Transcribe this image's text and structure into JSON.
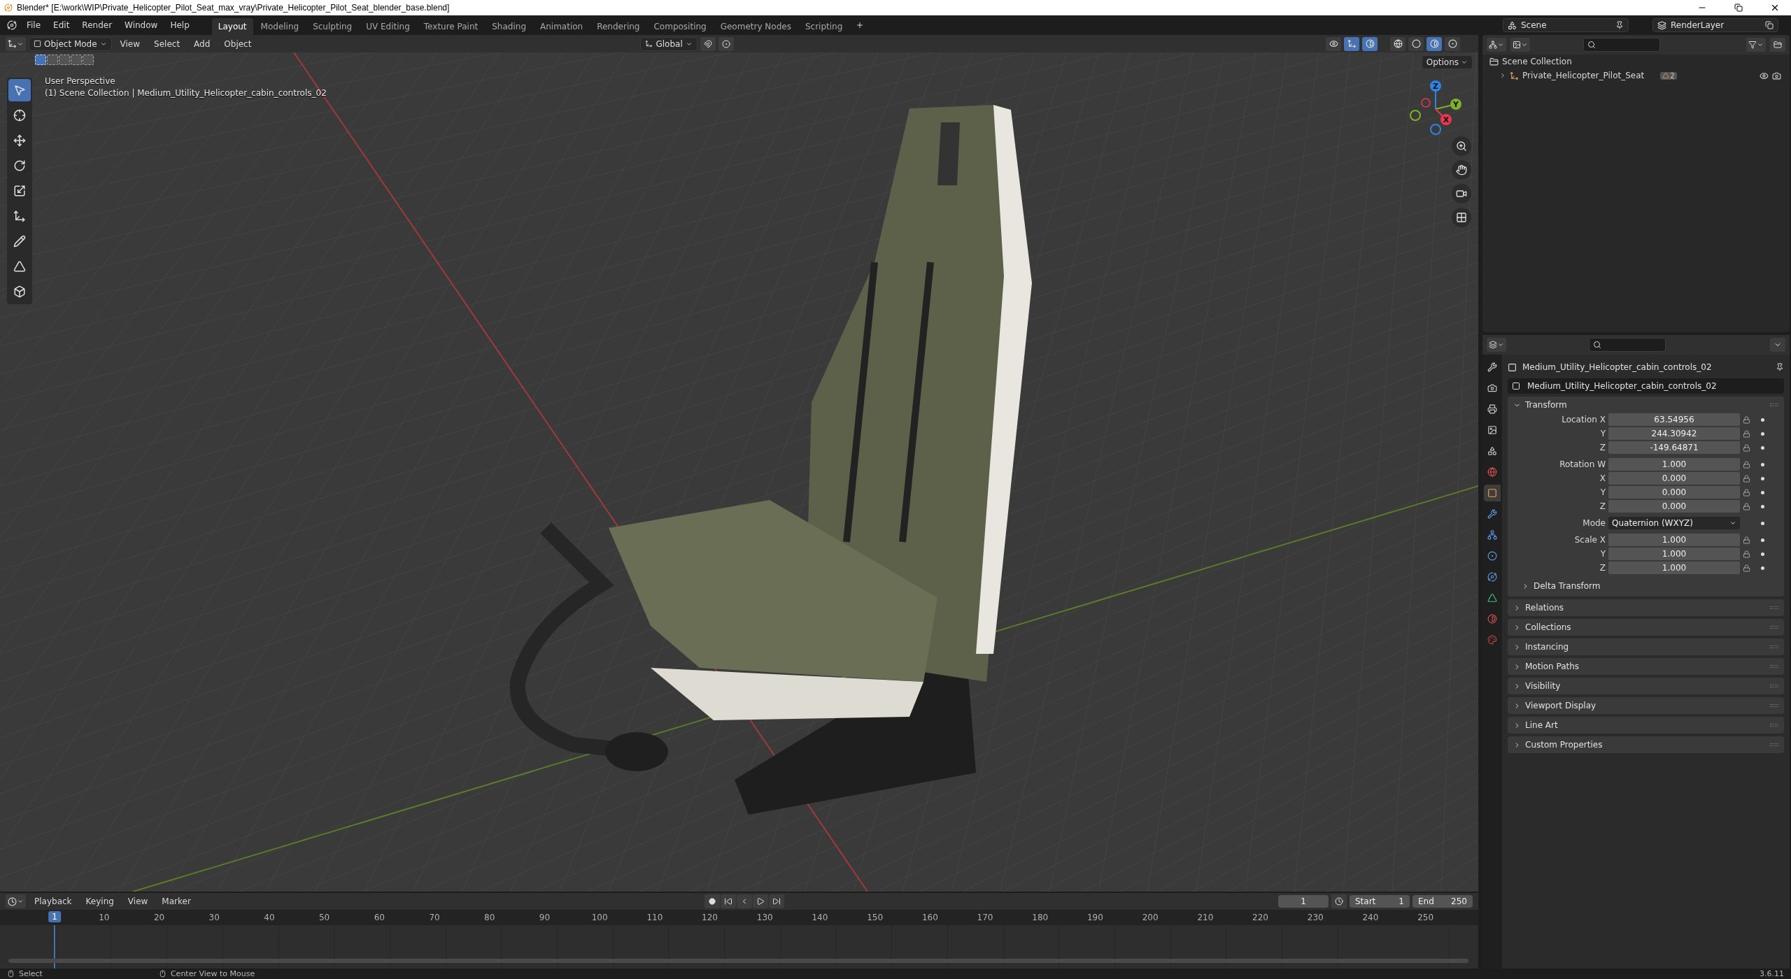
{
  "window": {
    "title": "Blender* [E:\\work\\WIP\\Private_Helicopter_Pilot_Seat_max_vray\\Private_Helicopter_Pilot_Seat_blender_base.blend]"
  },
  "menu": [
    "File",
    "Edit",
    "Render",
    "Window",
    "Help"
  ],
  "workspaces": [
    {
      "label": "Layout",
      "selected": true
    },
    {
      "label": "Modeling",
      "selected": false
    },
    {
      "label": "Sculpting",
      "selected": false
    },
    {
      "label": "UV Editing",
      "selected": false
    },
    {
      "label": "Texture Paint",
      "selected": false
    },
    {
      "label": "Shading",
      "selected": false
    },
    {
      "label": "Animation",
      "selected": false
    },
    {
      "label": "Rendering",
      "selected": false
    },
    {
      "label": "Compositing",
      "selected": false
    },
    {
      "label": "Geometry Nodes",
      "selected": false
    },
    {
      "label": "Scripting",
      "selected": false
    }
  ],
  "scene": {
    "name": "Scene",
    "view_layer": "RenderLayer"
  },
  "viewport": {
    "mode": "Object Mode",
    "menus": [
      "View",
      "Select",
      "Add",
      "Object"
    ],
    "orientation": "Global",
    "options": "Options",
    "select_modes": [
      {
        "selected": true
      },
      {
        "selected": false
      },
      {
        "selected": false
      },
      {
        "selected": false
      },
      {
        "selected": false
      }
    ],
    "shading": [
      {
        "kind": "wireframe",
        "selected": false
      },
      {
        "kind": "solid",
        "selected": false
      },
      {
        "kind": "material",
        "selected": true
      },
      {
        "kind": "rendered",
        "selected": false
      }
    ],
    "tools": [
      {
        "kind": "select",
        "selected": true
      },
      {
        "kind": "cursor",
        "selected": false
      },
      {
        "kind": "move",
        "selected": false
      },
      {
        "kind": "rotate",
        "selected": false
      },
      {
        "kind": "scale",
        "selected": false
      },
      {
        "kind": "transform",
        "selected": false
      },
      {
        "kind": "annotate",
        "selected": false
      },
      {
        "kind": "measure",
        "selected": false
      },
      {
        "kind": "add_cube",
        "selected": false
      }
    ],
    "overlay_text": [
      "User Perspective",
      "(1) Scene Collection | Medium_Utility_Helicopter_cabin_controls_02"
    ],
    "gizmo_axes": [
      "Z",
      "Y",
      "X"
    ]
  },
  "outliner": {
    "root": "Scene Collection",
    "children": [
      {
        "name": "Private_Helicopter_Pilot_Seat",
        "expanded": false,
        "badge": "2"
      }
    ]
  },
  "properties": {
    "tabs": [
      {
        "kind": "tool",
        "selected": false
      },
      {
        "kind": "render",
        "selected": false
      },
      {
        "kind": "output",
        "selected": false
      },
      {
        "kind": "view_layer",
        "selected": false
      },
      {
        "kind": "scene",
        "selected": false
      },
      {
        "kind": "world",
        "selected": false
      },
      {
        "kind": "object",
        "selected": true
      },
      {
        "kind": "modifiers",
        "selected": false
      },
      {
        "kind": "particles",
        "selected": false
      },
      {
        "kind": "physics",
        "selected": false
      },
      {
        "kind": "constraints",
        "selected": false
      },
      {
        "kind": "data",
        "selected": false
      },
      {
        "kind": "material",
        "selected": false
      },
      {
        "kind": "texture",
        "selected": false
      }
    ],
    "object_name": "Medium_Utility_Helicopter_cabin_controls_02",
    "data_name": "Medium_Utility_Helicopter_cabin_controls_02",
    "transform": {
      "title": "Transform",
      "expanded": true,
      "groups": [
        [
          {
            "label": "Location X",
            "value": "63.54956"
          },
          {
            "label": "Y",
            "value": "244.30942"
          },
          {
            "label": "Z",
            "value": "-149.64871"
          }
        ],
        [
          {
            "label": "Rotation W",
            "value": "1.000"
          },
          {
            "label": "X",
            "value": "0.000"
          },
          {
            "label": "Y",
            "value": "0.000"
          },
          {
            "label": "Z",
            "value": "0.000"
          }
        ],
        [
          {
            "label": "Mode",
            "value": "Quaternion (WXYZ)",
            "kind": "dropdown"
          }
        ],
        [
          {
            "label": "Scale X",
            "value": "1.000"
          },
          {
            "label": "Y",
            "value": "1.000"
          },
          {
            "label": "Z",
            "value": "1.000"
          }
        ]
      ],
      "subpanel": {
        "title": "Delta Transform",
        "expanded": false
      }
    },
    "panels": [
      {
        "title": "Relations",
        "expanded": false
      },
      {
        "title": "Collections",
        "expanded": false
      },
      {
        "title": "Instancing",
        "expanded": false
      },
      {
        "title": "Motion Paths",
        "expanded": false
      },
      {
        "title": "Visibility",
        "expanded": false
      },
      {
        "title": "Viewport Display",
        "expanded": false
      },
      {
        "title": "Line Art",
        "expanded": false
      },
      {
        "title": "Custom Properties",
        "expanded": false
      }
    ]
  },
  "timeline": {
    "menus": [
      "Playback",
      "Keying",
      "View",
      "Marker"
    ],
    "current_frame": "1",
    "start_label": "Start",
    "start": "1",
    "end_label": "End",
    "end": "250",
    "playhead": "1",
    "ticks": [
      "10",
      "20",
      "30",
      "40",
      "50",
      "60",
      "70",
      "80",
      "90",
      "100",
      "110",
      "120",
      "130",
      "140",
      "150",
      "160",
      "170",
      "180",
      "190",
      "200",
      "210",
      "220",
      "230",
      "240",
      "250"
    ]
  },
  "status_bar": {
    "items": [
      "Select",
      "Center View to Mouse"
    ],
    "version": "3.6.11"
  }
}
